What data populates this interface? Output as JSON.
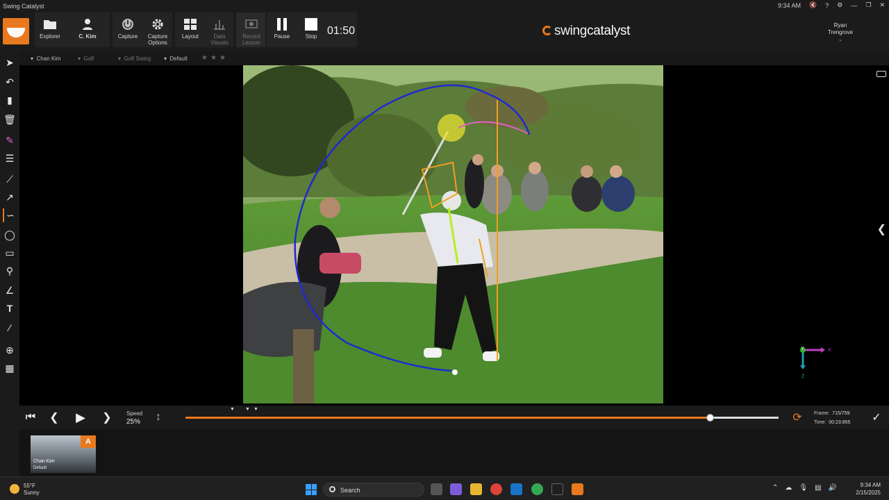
{
  "window": {
    "title": "Swing Catalyst",
    "clock": "9:34 AM",
    "controls": [
      "?",
      "✕"
    ]
  },
  "toolbar": {
    "explorer": "Explorer",
    "profile": "C. Kim",
    "capture": "Capture",
    "capture_options": "Capture Options",
    "layout": "Layout",
    "data_visuals": "Data Visuals",
    "record_lesson": "Record Lesson",
    "pause": "Pause",
    "stop": "Stop",
    "timer": "01:50"
  },
  "brand": {
    "name_a": "swing",
    "name_b": "catalyst"
  },
  "user": {
    "first": "Ryan",
    "last": "Trengrove"
  },
  "breadcrumb": {
    "player": "Chan Kim",
    "sport": "Golf",
    "category": "Golf Swing",
    "view": "Default"
  },
  "overlay_axes": {
    "y": "Y",
    "x": "X",
    "z": "Z"
  },
  "playback": {
    "speed_label": "Speed",
    "speed_value": "25%",
    "progress_fraction": 0.943,
    "frame_label": "Frame:",
    "frame_value": "715/759",
    "time_label": "Time:",
    "time_value": "00:23:855"
  },
  "clip": {
    "badge": "A",
    "name": "Chan Kim",
    "view": "Default"
  },
  "taskbar": {
    "temp": "55°F",
    "condition": "Sunny",
    "search": "Search",
    "time": "9:34 AM",
    "date": "2/15/2025"
  },
  "colors": {
    "accent": "#e8791f",
    "swing_arc": "#1e2ad0",
    "angle_lines": "#f0a020",
    "spine_line": "#b6ee1e",
    "club_path": "#e060c8"
  }
}
